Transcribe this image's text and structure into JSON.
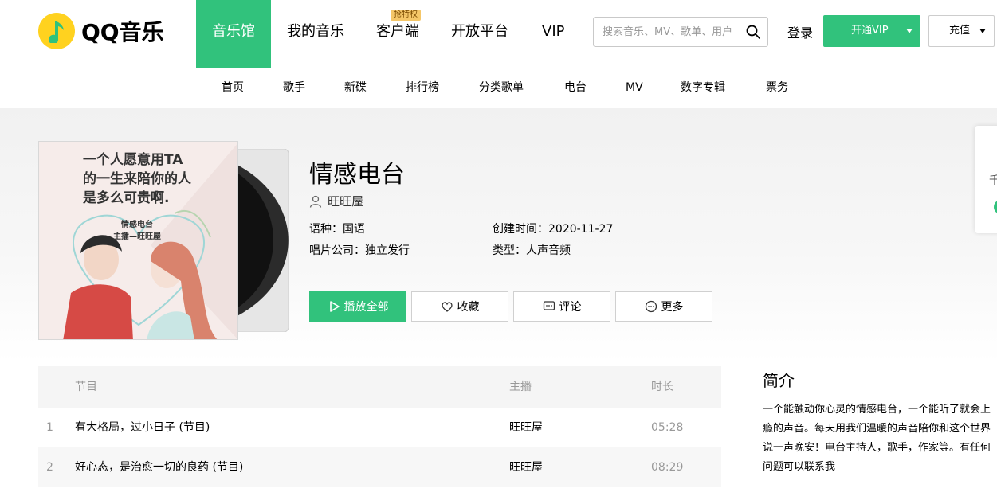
{
  "header": {
    "logo_text": "QQ音乐",
    "nav": [
      {
        "label": "音乐馆",
        "active": true
      },
      {
        "label": "我的音乐",
        "active": false
      },
      {
        "label": "客户端",
        "active": false,
        "badge": "抢特权"
      },
      {
        "label": "开放平台",
        "active": false
      },
      {
        "label": "VIP",
        "active": false
      }
    ],
    "search_placeholder": "搜索音乐、MV、歌单、用户",
    "login_label": "登录",
    "vip_button_label": "开通VIP",
    "recharge_button_label": "充值"
  },
  "subnav": [
    "首页",
    "歌手",
    "新碟",
    "排行榜",
    "分类歌单",
    "电台",
    "MV",
    "数字专辑",
    "票务"
  ],
  "album": {
    "title": "情感电台",
    "author": "旺旺屋",
    "meta": {
      "language": "语种：国语",
      "created": "创建时间：2020-11-27",
      "company": "唱片公司：独立发行",
      "type": "类型：人声音频"
    },
    "cover_text": {
      "line1": "一个人愿意用TA",
      "line2": "的一生来陪你的人",
      "line3": "是多么可贵啊.",
      "line4": "情感电台",
      "line5": "主播—旺旺屋"
    }
  },
  "actions": {
    "play_all": "播放全部",
    "favorite": "收藏",
    "comment": "评论",
    "more": "更多"
  },
  "float_card": {
    "text": "千"
  },
  "table": {
    "headers": {
      "program": "节目",
      "host": "主播",
      "duration": "时长"
    },
    "rows": [
      {
        "num": "1",
        "name": "有大格局，过小日子 (节目)",
        "host": "旺旺屋",
        "duration": "05:28"
      },
      {
        "num": "2",
        "name": "好心态，是治愈一切的良药 (节目)",
        "host": "旺旺屋",
        "duration": "08:29"
      }
    ]
  },
  "intro": {
    "title": "简介",
    "text": "一个能触动你心灵的情感电台，一个能听了就会上瘾的声音。每天用我们温暖的声音陪你和这个世界说一声晚安！电台主持人，歌手，作家等。有任何问题可以联系我"
  },
  "colors": {
    "accent": "#31c27c",
    "logo_yellow": "#ffd21f"
  }
}
